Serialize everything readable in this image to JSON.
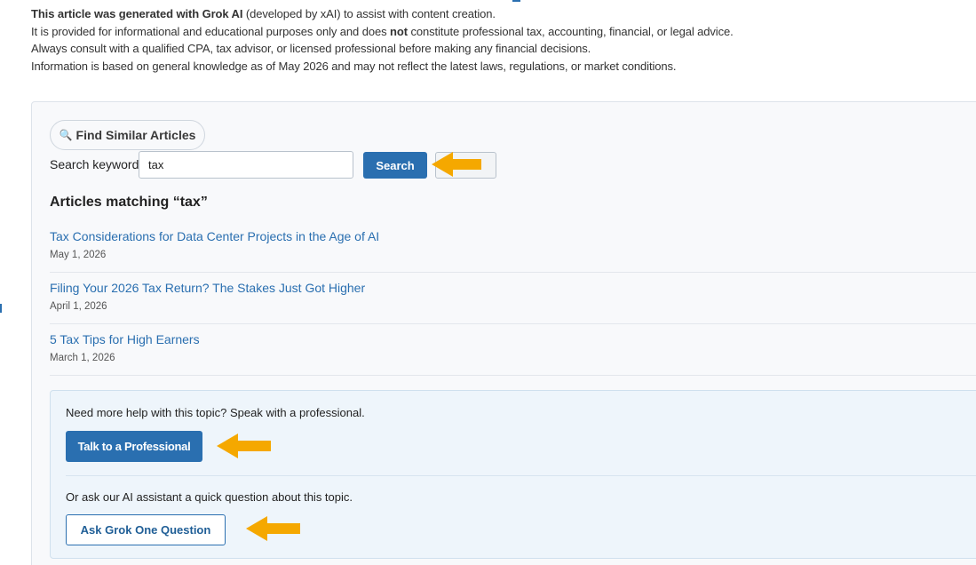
{
  "disclaimer": {
    "line1_bold": "This article was generated with Grok AI",
    "line1_rest": " (developed by xAI) to assist with content creation.",
    "line2_a": "It is provided for informational and educational purposes only and does ",
    "line2_bold": "not",
    "line2_b": " constitute professional tax, accounting, financial, or legal advice.",
    "line3": "Always consult with a qualified CPA, tax advisor, or licensed professional before making any financial decisions.",
    "line4": "Information is based on general knowledge as of May 2026 and may not reflect the latest laws, regulations, or market conditions."
  },
  "search": {
    "pill_label": "Find Similar Articles",
    "pill_icon": "magnifier-icon",
    "keyword_label": "Search keyword",
    "keyword_value": "tax",
    "search_button": "Search",
    "clear_button_visible": "l",
    "results_title": "Articles matching “tax”"
  },
  "results": [
    {
      "title": "Tax Considerations for Data Center Projects in the Age of AI",
      "date": "May 1, 2026"
    },
    {
      "title": "Filing Your 2026 Tax Return? The Stakes Just Got Higher",
      "date": "April 1, 2026"
    },
    {
      "title": "5 Tax Tips for High Earners",
      "date": "March 1, 2026"
    }
  ],
  "help": {
    "prompt": "Need more help with this topic? Speak with a professional.",
    "talk_button": "Talk to a Professional",
    "ai_prompt": "Or ask our AI assistant a quick question about this topic.",
    "ask_button": "Ask Grok One Question"
  },
  "colors": {
    "accent": "#2a6fb0",
    "arrow": "#f5a800",
    "link": "#2a6fb0"
  }
}
